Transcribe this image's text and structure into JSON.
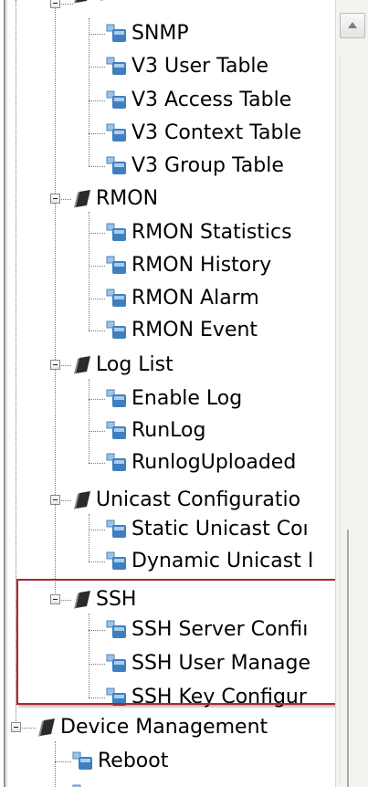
{
  "tree": {
    "top_partial_label": "SNMP",
    "groups": [
      {
        "key": "rmon",
        "label": "RMON"
      },
      {
        "key": "loglist",
        "label": "Log List"
      },
      {
        "key": "unicast",
        "label": "Unicast Configuratio"
      },
      {
        "key": "ssh",
        "label": "SSH"
      },
      {
        "key": "device",
        "label": "Device Management"
      }
    ],
    "items": {
      "snmp": "SNMP",
      "v3_user": "V3 User Table",
      "v3_access": "V3 Access Table",
      "v3_context": "V3 Context Table",
      "v3_group": "V3 Group Table",
      "rmon_stats": "RMON Statistics",
      "rmon_history": "RMON History",
      "rmon_alarm": "RMON Alarm",
      "rmon_event": "RMON Event",
      "enable_log": "Enable Log",
      "runlog": "RunLog",
      "runlog_uploaded": "RunlogUploaded",
      "static_unicast": "Static Unicast Coı",
      "dynamic_unicast": "Dynamic Unicast I",
      "ssh_server": "SSH Server Confiı",
      "ssh_user": "SSH User Manage",
      "ssh_key": "SSH Key Configur",
      "reboot": "Reboot"
    }
  },
  "colors": {
    "highlight": "#b1262b",
    "page_icon_blue": "#3f7fc0",
    "folder_dark": "#2b2b2b"
  }
}
